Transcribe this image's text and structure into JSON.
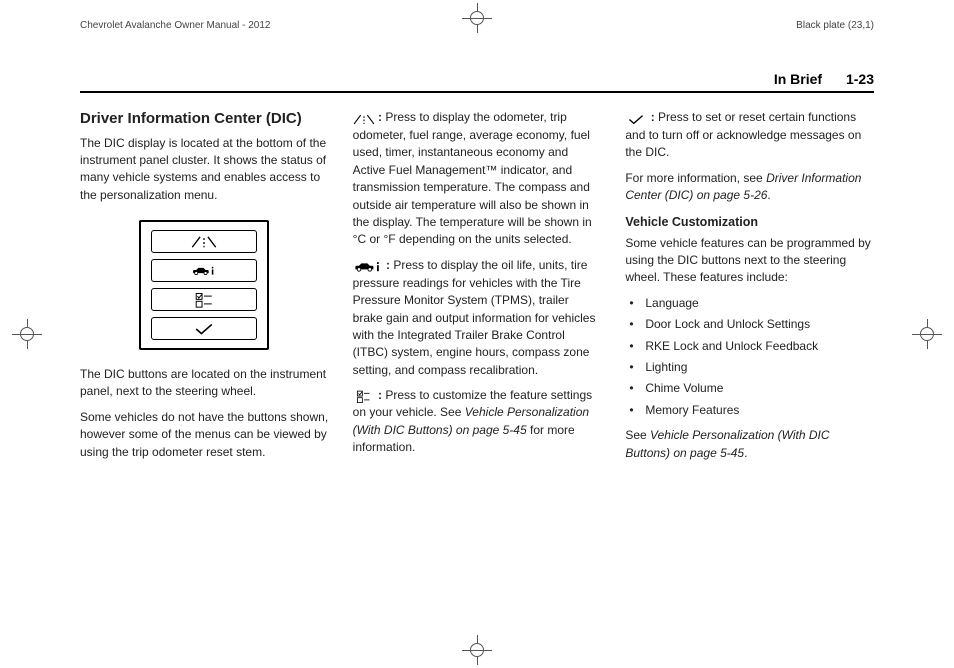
{
  "top": {
    "left": "Chevrolet Avalanche Owner Manual - 2012",
    "right": "Black plate (23,1)"
  },
  "header": {
    "section": "In Brief",
    "page": "1-23"
  },
  "col1": {
    "h2": "Driver Information Center (DIC)",
    "p1": "The DIC display is located at the bottom of the instrument panel cluster. It shows the status of many vehicle systems and enables access to the personalization menu.",
    "p2": "The DIC buttons are located on the instrument panel, next to the steering wheel.",
    "p3": "Some vehicles do not have the buttons shown, however some of the menus can be viewed by using the trip odometer reset stem."
  },
  "col2": {
    "icon1_label": ":",
    "p1": " Press to display the odometer, trip odometer, fuel range, average economy, fuel used, timer, instantaneous economy and Active Fuel Management™ indicator, and transmission temperature. The compass and outside air temperature will also be shown in the display. The temperature will be shown in °C or °F depending on the units selected.",
    "icon2_label": ":",
    "p2": " Press to display the oil life, units, tire pressure readings for vehicles with the Tire Pressure Monitor System (TPMS), trailer brake gain and output information for vehicles with the Integrated Trailer Brake Control (ITBC) system, engine hours, compass zone setting, and compass recalibration.",
    "icon3_label": ":",
    "p3a": " Press to customize the feature settings on your vehicle. See ",
    "p3_link": "Vehicle Personalization (With DIC Buttons) on page 5-45",
    "p3b": " for more information."
  },
  "col3": {
    "icon1_label": ":",
    "p1": " Press to set or reset certain functions and to turn off or acknowledge messages on the DIC.",
    "p2a": "For more information, see ",
    "p2_link": "Driver Information Center (DIC) on page 5-26",
    "p2b": ".",
    "h3": "Vehicle Customization",
    "p3": "Some vehicle features can be programmed by using the DIC buttons next to the steering wheel. These features include:",
    "items": [
      "Language",
      "Door Lock and Unlock Settings",
      "RKE Lock and Unlock Feedback",
      "Lighting",
      "Chime Volume",
      "Memory Features"
    ],
    "p4a": "See ",
    "p4_link": "Vehicle Personalization (With DIC Buttons) on page 5-45",
    "p4b": "."
  }
}
